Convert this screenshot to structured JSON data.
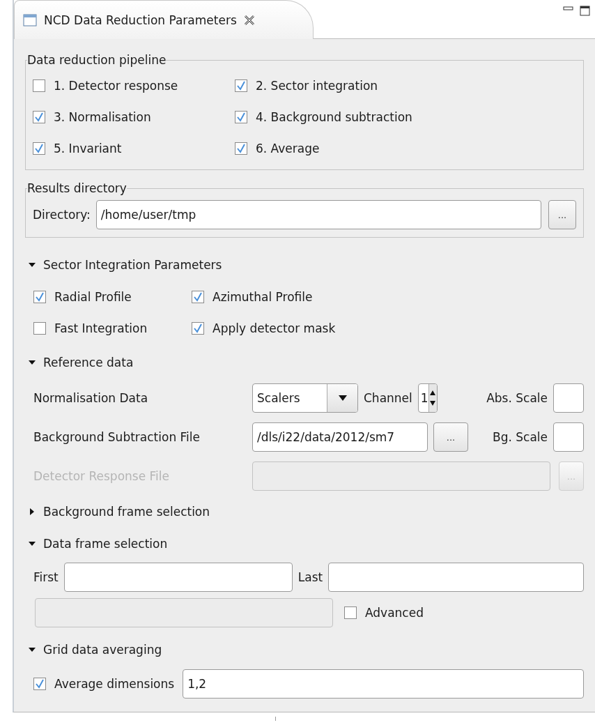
{
  "tab": {
    "title": "NCD Data Reduction Parameters",
    "selected": true
  },
  "pipeline": {
    "title": "Data reduction pipeline",
    "steps": [
      {
        "label": "1. Detector response",
        "checked": false
      },
      {
        "label": "2. Sector integration",
        "checked": true
      },
      {
        "label": "3. Normalisation",
        "checked": true
      },
      {
        "label": "4. Background subtraction",
        "checked": true
      },
      {
        "label": "5. Invariant",
        "checked": true
      },
      {
        "label": "6. Average",
        "checked": true
      }
    ]
  },
  "results": {
    "title": "Results directory",
    "label": "Directory:",
    "value": "/home/user/tmp",
    "browse": "..."
  },
  "sector": {
    "title": "Sector Integration Parameters",
    "expanded": true,
    "options": [
      {
        "label": "Radial Profile",
        "checked": true
      },
      {
        "label": "Azimuthal Profile",
        "checked": true
      },
      {
        "label": "Fast Integration",
        "checked": false
      },
      {
        "label": "Apply detector mask",
        "checked": true
      }
    ]
  },
  "reference": {
    "title": "Reference data",
    "expanded": true,
    "normalisation": {
      "label": "Normalisation Data",
      "value": "Scalers",
      "channel_label": "Channel",
      "channel": "1",
      "abs_scale_label": "Abs. Scale"
    },
    "background": {
      "label": "Background Subtraction File",
      "value": "/dls/i22/data/2012/sm7",
      "browse": "...",
      "bg_scale_label": "Bg. Scale"
    },
    "detector": {
      "label": "Detector Response File",
      "browse": "...",
      "disabled": true
    }
  },
  "background_frames": {
    "title": "Background frame selection",
    "expanded": false
  },
  "data_frames": {
    "title": "Data frame selection",
    "expanded": true,
    "first_label": "First",
    "last_label": "Last",
    "advanced": {
      "label": "Advanced",
      "checked": false
    }
  },
  "grid": {
    "title": "Grid data averaging",
    "expanded": true,
    "average": {
      "label": "Average dimensions",
      "checked": true,
      "value": "1,2"
    }
  }
}
